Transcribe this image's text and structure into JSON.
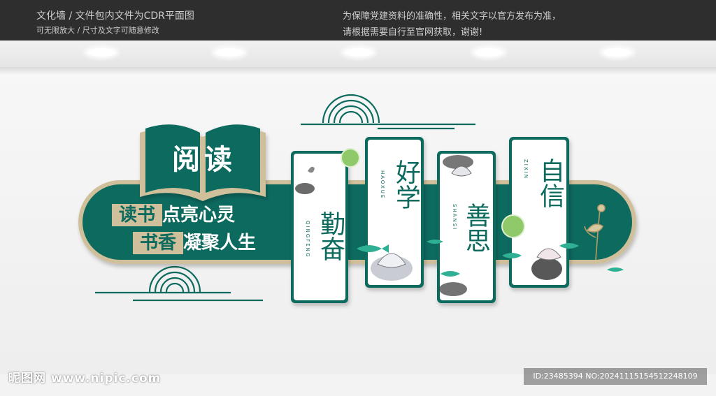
{
  "header": {
    "left_line1": "文化墙 / 文件包内文件为CDR平面图",
    "left_line2": "可无限放大 / 尺寸及文字可随意修改",
    "right_line1": "为保障党建资料的准确性，相关文字以官方发布为准，",
    "right_line2": "请根据需要自行至官网获取，谢谢!"
  },
  "book": {
    "title": "阅读",
    "slogan_line1_box": "读书",
    "slogan_line1_rest": "点亮心灵",
    "slogan_line2_box": "书香",
    "slogan_line2_rest": "凝聚人生"
  },
  "panels": [
    {
      "title": "勤奋",
      "pinyin": "QINGFENG"
    },
    {
      "title": "好学",
      "pinyin": "HAOXUE"
    },
    {
      "title": "善思",
      "pinyin": "SHANSI"
    },
    {
      "title": "自信",
      "pinyin": "ZIXIN"
    }
  ],
  "watermark": {
    "site": "昵图网 www.nipic.com",
    "id": "ID:23485394 NO:20241115154512248109"
  },
  "colors": {
    "green": "#0c6b5e",
    "tan": "#cfbf9a",
    "light_green": "#8fc96a",
    "topbar": "#2e2e2e"
  }
}
